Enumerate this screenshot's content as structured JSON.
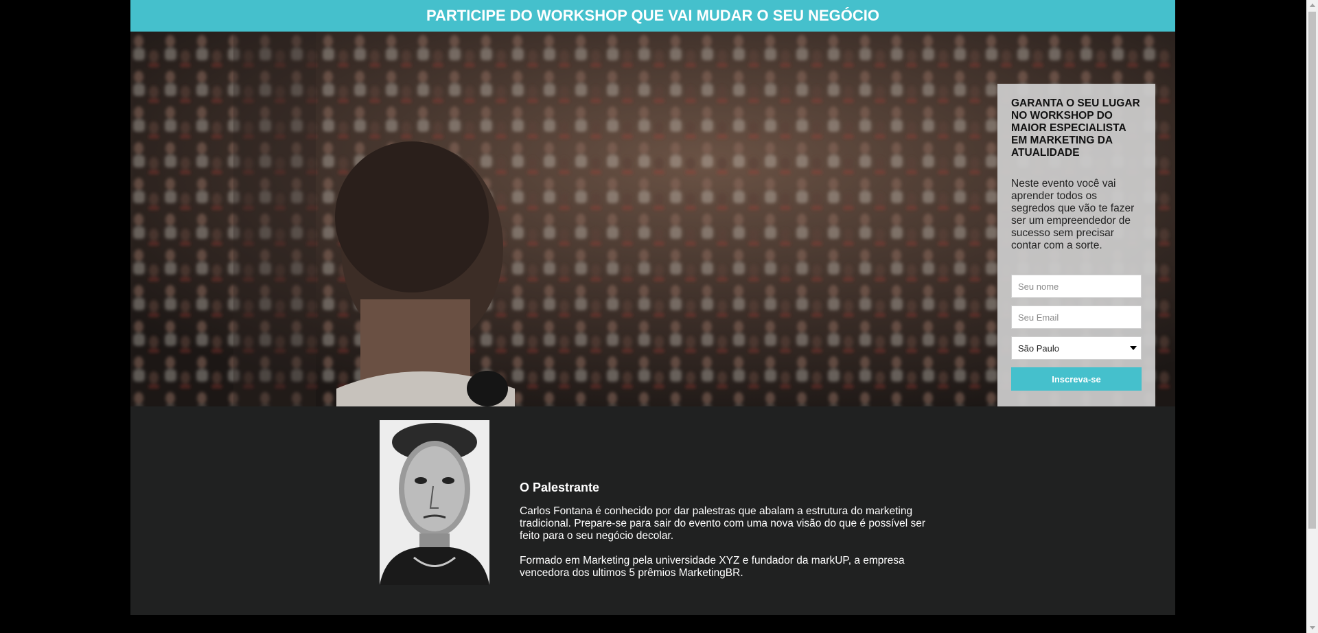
{
  "header": {
    "title": "PARTICIPE DO WORKSHOP QUE VAI MUDAR O SEU NEGÓCIO"
  },
  "signup": {
    "title": "GARANTA O SEU LUGAR NO WORKSHOP DO MAIOR ESPECIALISTA EM MARKETING DA ATUALIDADE",
    "description": "Neste evento você vai aprender todos os segredos que vão te fazer ser um empreendedor de sucesso sem precisar contar com a sorte.",
    "name_placeholder": "Seu nome",
    "email_placeholder": "Seu Email",
    "city_selected": "São Paulo",
    "submit_label": "Inscreva-se"
  },
  "speaker": {
    "heading": "O Palestrante",
    "paragraph1": "Carlos Fontana é conhecido por dar palestras que abalam a estrutura do marketing tradicional. Prepare-se para sair do evento com uma nova visão do que é possível ser feito para o seu negócio decolar.",
    "paragraph2": "Formado em Marketing pela universidade XYZ e fundador da markUP, a empresa vencedora dos ultimos 5 prêmios MarketingBR."
  },
  "colors": {
    "accent": "#45c0cc",
    "page_background": "#202121",
    "outer_background": "#000000"
  },
  "icons": {
    "select_arrow": "chevron-down-icon"
  }
}
